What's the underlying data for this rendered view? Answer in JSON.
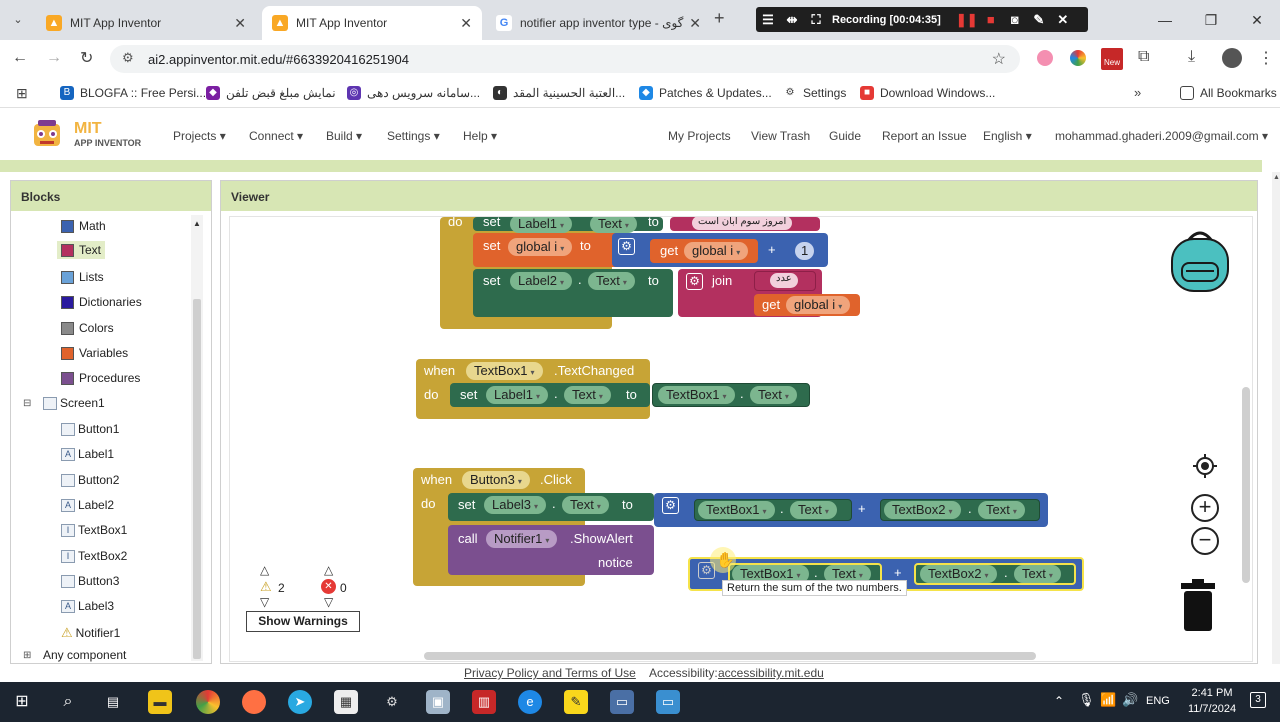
{
  "browser": {
    "tabs": [
      {
        "title": "MIT App Inventor",
        "active": false
      },
      {
        "title": "MIT App Inventor",
        "active": true
      },
      {
        "title": "notifier app inventor type - گوی",
        "active": false
      }
    ],
    "new_tab": "+",
    "tab_close": "✕",
    "url": "ai2.appinventor.mit.edu/#6633920416251904",
    "recording": "Recording [00:04:35]",
    "bookmarks": [
      "BLOGFA :: Free Persi...",
      "نمایش مبلغ قبض تلفن",
      "سامانه سرویس دهی...",
      "العتبة الحسينية المقد...",
      "Patches & Updates...",
      "Settings",
      "Download Windows..."
    ],
    "all_bookmarks": "All Bookmarks"
  },
  "app": {
    "logo_mit": "MIT",
    "logo_sub": "APP INVENTOR",
    "menu_left": [
      "Projects",
      "Connect",
      "Build",
      "Settings",
      "Help"
    ],
    "menu_right": [
      "My Projects",
      "View Trash",
      "Guide",
      "Report an Issue",
      "English"
    ],
    "user": "mohammad.ghaderi.2009@gmail.com"
  },
  "blocks_panel": {
    "title": "Blocks",
    "builtins": [
      {
        "label": "Math",
        "color": "#3b62b0"
      },
      {
        "label": "Text",
        "color": "#b3305f"
      },
      {
        "label": "Lists",
        "color": "#6aa2d8"
      },
      {
        "label": "Dictionaries",
        "color": "#2a1a9e"
      },
      {
        "label": "Colors",
        "color": "#8a8a8a"
      },
      {
        "label": "Variables",
        "color": "#e0632c"
      },
      {
        "label": "Procedures",
        "color": "#7b4f8f"
      }
    ],
    "screen": "Screen1",
    "components": [
      "Button1",
      "Label1",
      "Button2",
      "Label2",
      "TextBox1",
      "TextBox2",
      "Button3",
      "Label3",
      "Notifier1"
    ],
    "any_component": "Any component"
  },
  "viewer": {
    "title": "Viewer",
    "warnings_count": "2",
    "errors_count": "0",
    "show_warnings": "Show Warnings",
    "tooltip": "Return the sum of the two numbers."
  },
  "blocks": {
    "do": "do",
    "set": "set",
    "to": "to",
    "get": "get",
    "when": "when",
    "call": "call",
    "join": "join",
    "plus": "+",
    "dot": ".",
    "label1": "Label1",
    "label2": "Label2",
    "label3": "Label3",
    "text_prop": "Text",
    "global_i": "global i",
    "one": "1",
    "persian_str1": "امروز سوم ابان است",
    "persian_str2": "عدد",
    "textbox1": "TextBox1",
    "textbox2": "TextBox2",
    "textchanged": ".TextChanged",
    "button3": "Button3",
    "click": ".Click",
    "notifier1": "Notifier1",
    "showalert": ".ShowAlert",
    "notice": "notice"
  },
  "footer": {
    "privacy": "Privacy Policy and Terms of Use",
    "accessibility_label": "Accessibility:",
    "accessibility_link": "accessibility.mit.edu"
  },
  "taskbar": {
    "lang": "ENG",
    "time": "2:41 PM",
    "date": "11/7/2024"
  }
}
